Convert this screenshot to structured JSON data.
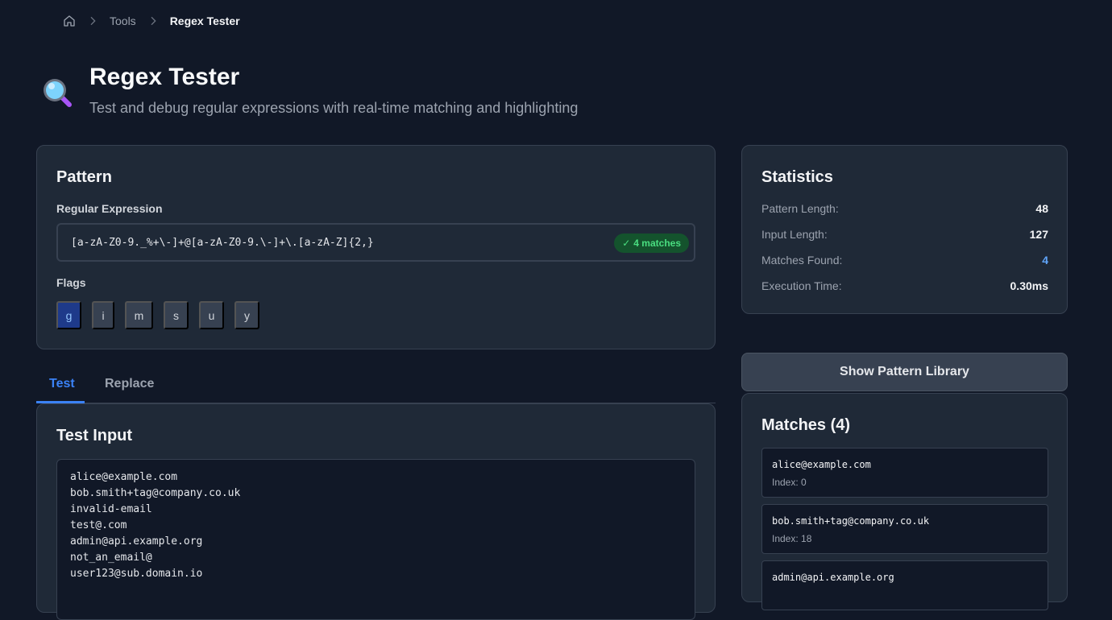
{
  "breadcrumb": {
    "home_icon": "home-icon",
    "tools": "Tools",
    "current": "Regex Tester"
  },
  "header": {
    "icon": "magnifying-glass-icon",
    "title": "Regex Tester",
    "subtitle": "Test and debug regular expressions with real-time matching and highlighting"
  },
  "pattern": {
    "title": "Pattern",
    "regex_label": "Regular Expression",
    "regex_value": "[a-zA-Z0-9._%+\\-]+@[a-zA-Z0-9.\\-]+\\.[a-zA-Z]{2,}",
    "match_badge": "4 matches",
    "flags_label": "Flags",
    "flags": [
      {
        "label": "g",
        "active": true
      },
      {
        "label": "i",
        "active": false
      },
      {
        "label": "m",
        "active": false
      },
      {
        "label": "s",
        "active": false
      },
      {
        "label": "u",
        "active": false
      },
      {
        "label": "y",
        "active": false
      }
    ]
  },
  "tabs": {
    "test": "Test",
    "replace": "Replace",
    "active": "Test"
  },
  "test_input": {
    "title": "Test Input",
    "value": "alice@example.com\nbob.smith+tag@company.co.uk\ninvalid-email\ntest@.com\nadmin@api.example.org\nnot_an_email@\nuser123@sub.domain.io"
  },
  "statistics": {
    "title": "Statistics",
    "rows": [
      {
        "label": "Pattern Length:",
        "value": "48"
      },
      {
        "label": "Input Length:",
        "value": "127"
      },
      {
        "label": "Matches Found:",
        "value": "4"
      },
      {
        "label": "Execution Time:",
        "value": "0.30ms"
      }
    ]
  },
  "library_button": "Show Pattern Library",
  "matches": {
    "title": "Matches (4)",
    "items": [
      {
        "text": "alice@example.com",
        "index": "Index: 0"
      },
      {
        "text": "bob.smith+tag@company.co.uk",
        "index": "Index: 18"
      },
      {
        "text": "admin@api.example.org",
        "index": ""
      }
    ]
  },
  "colors": {
    "accent": "#3b82f6",
    "success": "#4ade80",
    "background": "#111827"
  }
}
